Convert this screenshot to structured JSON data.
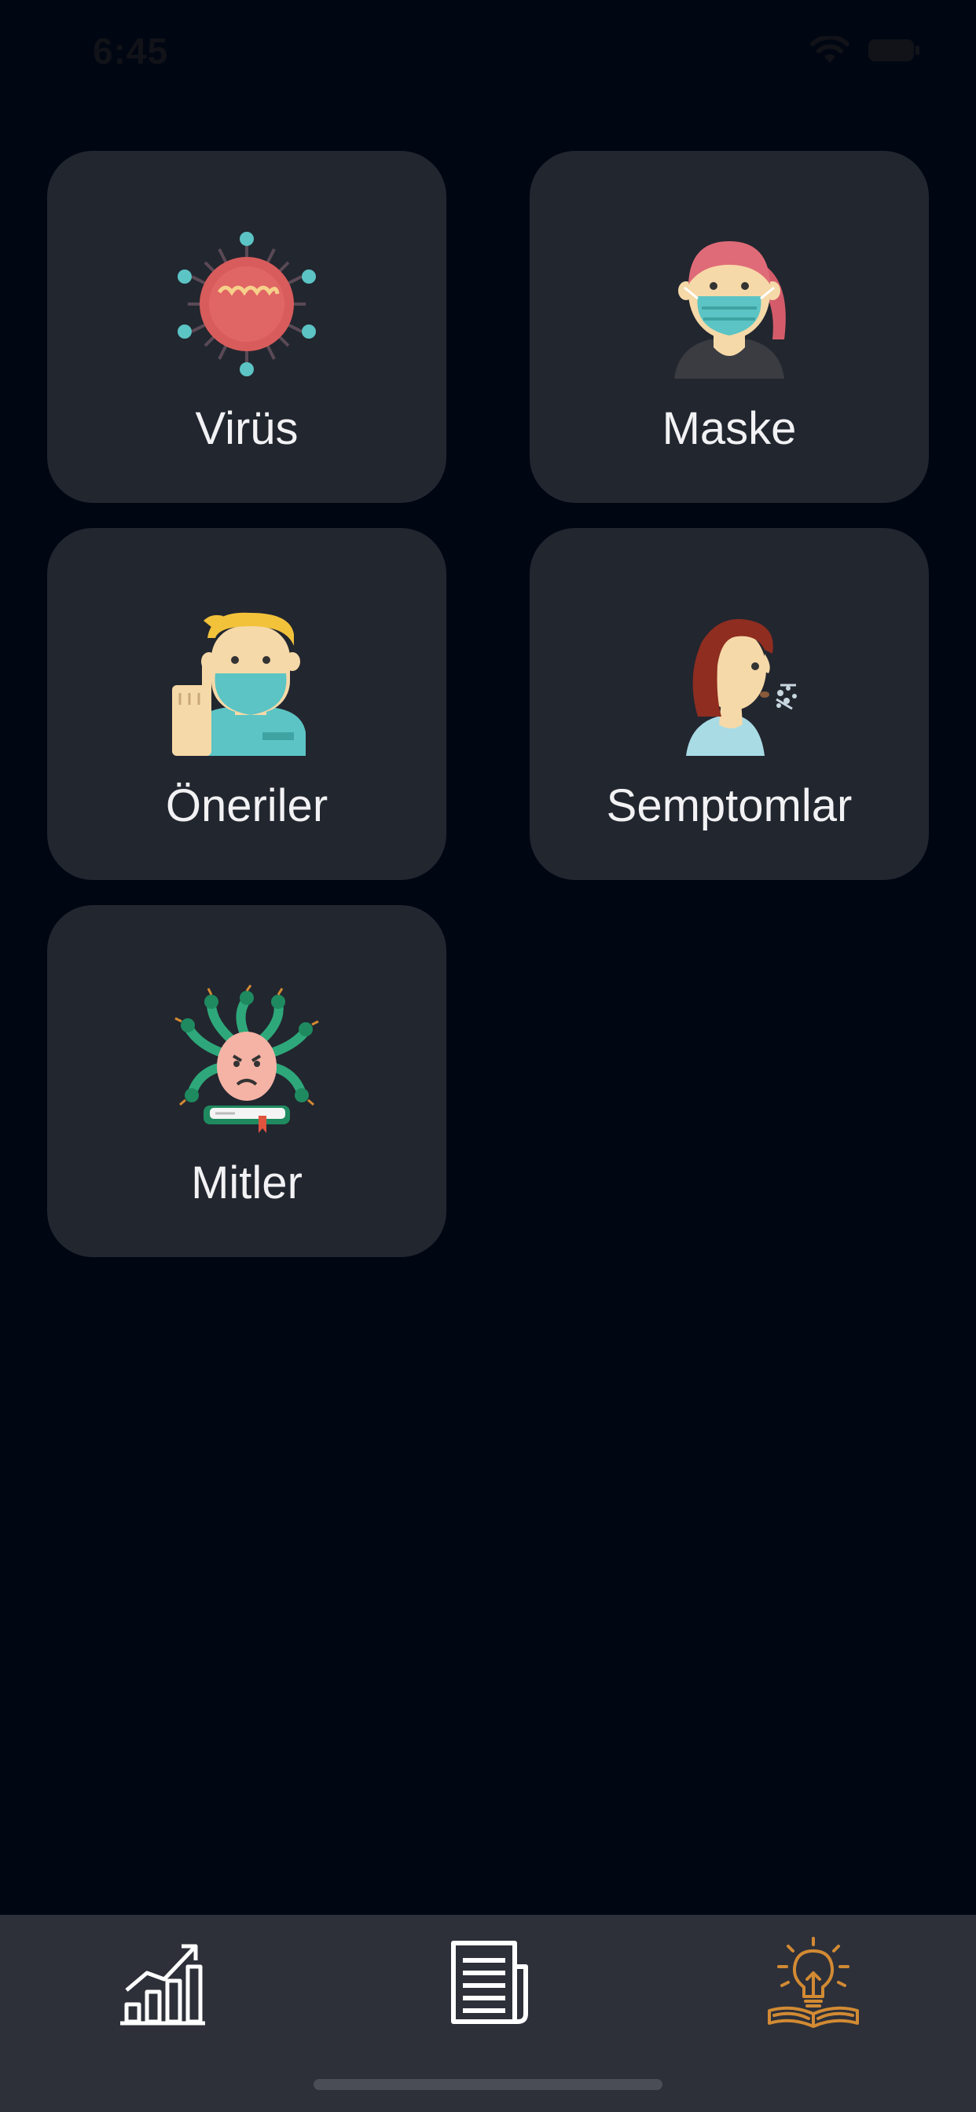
{
  "status_bar": {
    "time": "6:45"
  },
  "cards": [
    {
      "label": "Virüs",
      "icon": "virus-icon"
    },
    {
      "label": "Maske",
      "icon": "masked-woman-icon"
    },
    {
      "label": "Öneriler",
      "icon": "masked-man-advice-icon"
    },
    {
      "label": "Semptomlar",
      "icon": "coughing-woman-icon"
    },
    {
      "label": "Mitler",
      "icon": "medusa-myth-icon"
    }
  ],
  "tab_bar": {
    "tabs": [
      {
        "icon": "statistics-chart-icon",
        "active": false
      },
      {
        "icon": "news-icon",
        "active": false
      },
      {
        "icon": "lightbulb-book-icon",
        "active": true
      }
    ],
    "active_color": "#d28a33",
    "inactive_color": "#ffffff"
  },
  "colors": {
    "background": "#010613",
    "card": "#22262f",
    "tab_bar": "#2d3039"
  }
}
